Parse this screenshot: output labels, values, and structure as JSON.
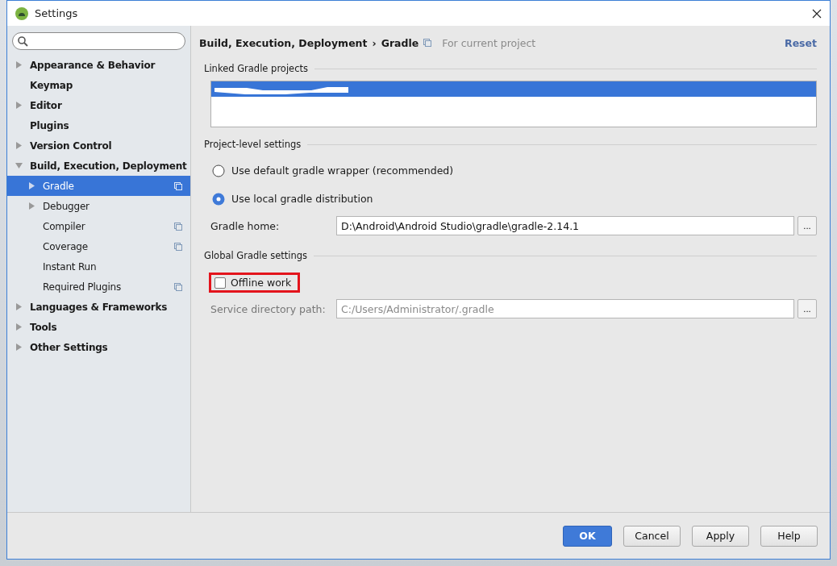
{
  "window": {
    "title": "Settings"
  },
  "sidebar": {
    "items": [
      {
        "label": "Appearance & Behavior",
        "expanded": false,
        "selected": false
      },
      {
        "label": "Keymap",
        "selected": false
      },
      {
        "label": "Editor",
        "expanded": false,
        "selected": false
      },
      {
        "label": "Plugins",
        "selected": false
      },
      {
        "label": "Version Control",
        "expanded": false,
        "selected": false
      },
      {
        "label": "Build, Execution, Deployment",
        "expanded": true,
        "selected": false,
        "children": [
          {
            "label": "Gradle",
            "expanded": false,
            "selected": true,
            "project_level": true
          },
          {
            "label": "Debugger",
            "expanded": false,
            "selected": false,
            "project_level": false
          },
          {
            "label": "Compiler",
            "selected": false,
            "project_level": true
          },
          {
            "label": "Coverage",
            "selected": false,
            "project_level": true
          },
          {
            "label": "Instant Run",
            "selected": false,
            "project_level": false
          },
          {
            "label": "Required Plugins",
            "selected": false,
            "project_level": true
          }
        ]
      },
      {
        "label": "Languages & Frameworks",
        "expanded": false,
        "selected": false
      },
      {
        "label": "Tools",
        "expanded": false,
        "selected": false
      },
      {
        "label": "Other Settings",
        "expanded": false,
        "selected": false
      }
    ]
  },
  "header": {
    "breadcrumb": [
      "Build, Execution, Deployment",
      "›",
      "Gradle"
    ],
    "scope": "For current project",
    "reset": "Reset"
  },
  "linked": {
    "title": "Linked Gradle projects",
    "rows": [
      {
        "selected": true,
        "redacted": true
      }
    ]
  },
  "project_level": {
    "title": "Project-level settings",
    "options": [
      {
        "label": "Use default gradle wrapper (recommended)",
        "selected": false
      },
      {
        "label": "Use local gradle distribution",
        "selected": true
      }
    ],
    "gradle_home": {
      "label": "Gradle home:",
      "value": "D:\\Android\\Android Studio\\gradle\\gradle-2.14.1",
      "disabled": false,
      "browse": "..."
    }
  },
  "global": {
    "title": "Global Gradle settings",
    "offline": {
      "label": "Offline work",
      "checked": false,
      "highlighted": true
    },
    "service_dir": {
      "label": "Service directory path:",
      "value": "C:/Users/Administrator/.gradle",
      "disabled": true,
      "browse": "..."
    }
  },
  "buttons": [
    {
      "label": "OK",
      "default": true
    },
    {
      "label": "Cancel",
      "default": false
    },
    {
      "label": "Apply",
      "default": false
    },
    {
      "label": "Help",
      "default": false
    }
  ]
}
